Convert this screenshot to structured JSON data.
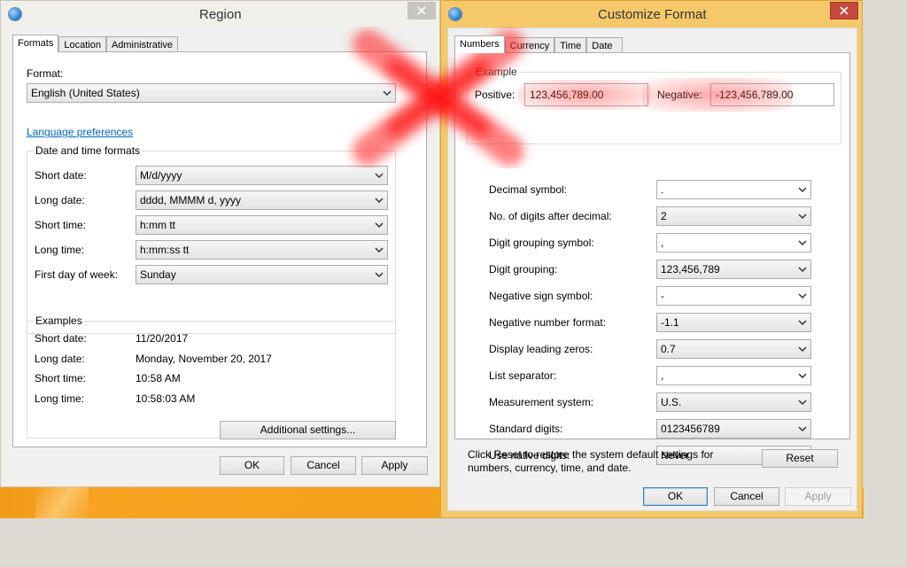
{
  "region": {
    "title": "Region",
    "tabs": [
      "Formats",
      "Location",
      "Administrative"
    ],
    "format_label": "Format:",
    "format_value": "English (United States)",
    "language_link": "Language preferences",
    "dt_group_title": "Date and time formats",
    "dt_rows": [
      {
        "label": "Short date:",
        "value": "M/d/yyyy"
      },
      {
        "label": "Long date:",
        "value": "dddd, MMMM d, yyyy"
      },
      {
        "label": "Short time:",
        "value": "h:mm tt"
      },
      {
        "label": "Long time:",
        "value": "h:mm:ss tt"
      },
      {
        "label": "First day of week:",
        "value": "Sunday"
      }
    ],
    "examples_title": "Examples",
    "examples": [
      {
        "label": "Short date:",
        "value": "11/20/2017"
      },
      {
        "label": "Long date:",
        "value": "Monday, November 20, 2017"
      },
      {
        "label": "Short time:",
        "value": "10:58 AM"
      },
      {
        "label": "Long time:",
        "value": "10:58:03 AM"
      }
    ],
    "additional_settings": "Additional settings...",
    "ok": "OK",
    "cancel": "Cancel",
    "apply": "Apply"
  },
  "customize": {
    "title": "Customize Format",
    "close_glyph": "✕",
    "tabs": [
      "Numbers",
      "Currency",
      "Time",
      "Date"
    ],
    "example_title": "Example",
    "positive_label": "Positive:",
    "positive_value": "123,456,789.00",
    "negative_label": "Negative:",
    "negative_value": "-123,456,789.00",
    "settings": [
      {
        "label": "Decimal symbol:",
        "value": "."
      },
      {
        "label": "No. of digits after decimal:",
        "value": "2"
      },
      {
        "label": "Digit grouping symbol:",
        "value": ","
      },
      {
        "label": "Digit grouping:",
        "value": "123,456,789"
      },
      {
        "label": "Negative sign symbol:",
        "value": "-"
      },
      {
        "label": "Negative number format:",
        "value": "-1.1"
      },
      {
        "label": "Display leading zeros:",
        "value": "0.7"
      },
      {
        "label": "List separator:",
        "value": ","
      },
      {
        "label": "Measurement system:",
        "value": "U.S."
      },
      {
        "label": "Standard digits:",
        "value": "0123456789"
      },
      {
        "label": "Use native digits:",
        "value": "Never"
      }
    ],
    "reset_text_line1": "Click Reset to restore the system default settings for",
    "reset_text_line2": "numbers, currency, time, and date.",
    "reset": "Reset",
    "ok": "OK",
    "cancel": "Cancel",
    "apply": "Apply"
  },
  "colors": {
    "highlight_red": "#ff3b3b",
    "active_frame": "#f5c96a",
    "taskbar": "#f4a11b"
  }
}
